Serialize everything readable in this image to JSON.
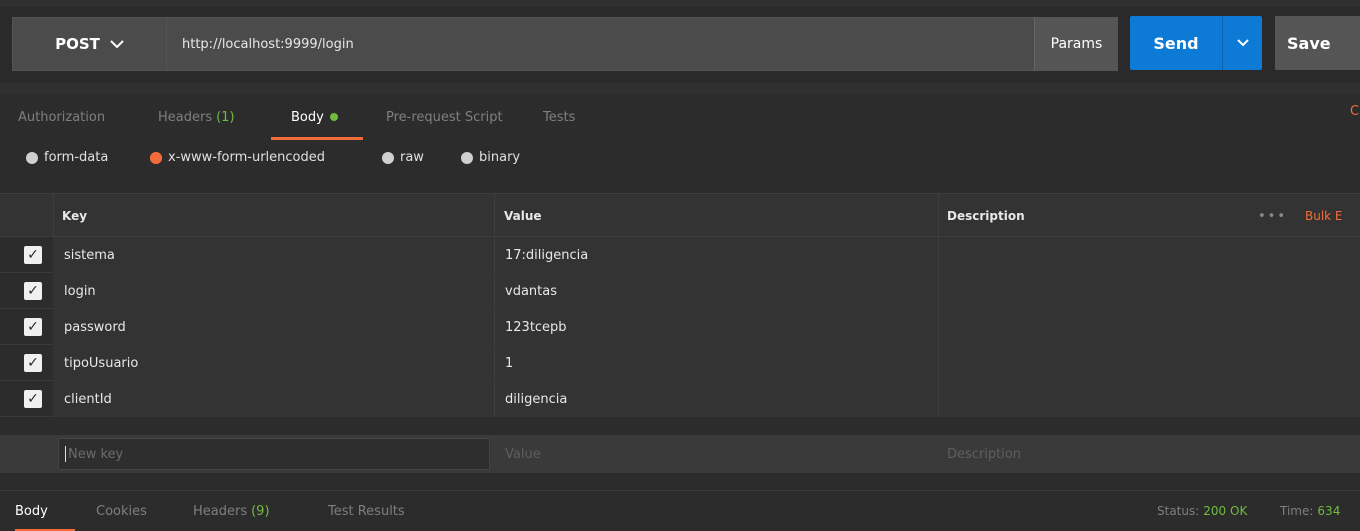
{
  "request": {
    "method": "POST",
    "url": "http://localhost:9999/login",
    "params_label": "Params",
    "send_label": "Send",
    "save_label": "Save"
  },
  "tabs": [
    {
      "label": "Authorization"
    },
    {
      "label": "Headers",
      "count": "(1)"
    },
    {
      "label": "Body",
      "active": true
    },
    {
      "label": "Pre-request Script"
    },
    {
      "label": "Tests"
    }
  ],
  "edge_link": "C",
  "body_types": [
    {
      "label": "form-data",
      "checked": false
    },
    {
      "label": "x-www-form-urlencoded",
      "checked": true
    },
    {
      "label": "raw",
      "checked": false
    },
    {
      "label": "binary",
      "checked": false
    }
  ],
  "table": {
    "headers": {
      "key": "Key",
      "value": "Value",
      "description": "Description"
    },
    "more": "•••",
    "bulk_edit": "Bulk E",
    "rows": [
      {
        "key": "sistema",
        "value": "17:diligencia",
        "checked": true
      },
      {
        "key": "login",
        "value": "vdantas",
        "checked": true
      },
      {
        "key": "password",
        "value": "123tcepb",
        "checked": true
      },
      {
        "key": "tipoUsuario",
        "value": "1",
        "checked": true
      },
      {
        "key": "clientId",
        "value": "diligencia",
        "checked": true
      }
    ],
    "new_row": {
      "key_placeholder": "New key",
      "value_placeholder": "Value",
      "description_placeholder": "Description"
    }
  },
  "response": {
    "tabs": [
      {
        "label": "Body",
        "active": true
      },
      {
        "label": "Cookies"
      },
      {
        "label": "Headers",
        "count": "(9)"
      },
      {
        "label": "Test Results"
      }
    ],
    "status_label": "Status:",
    "status_value": "200 OK",
    "time_label": "Time:",
    "time_value": "634"
  },
  "colors": {
    "accent": "#f26b3a",
    "primary": "#0d7ad6",
    "success": "#6fbc3f"
  }
}
